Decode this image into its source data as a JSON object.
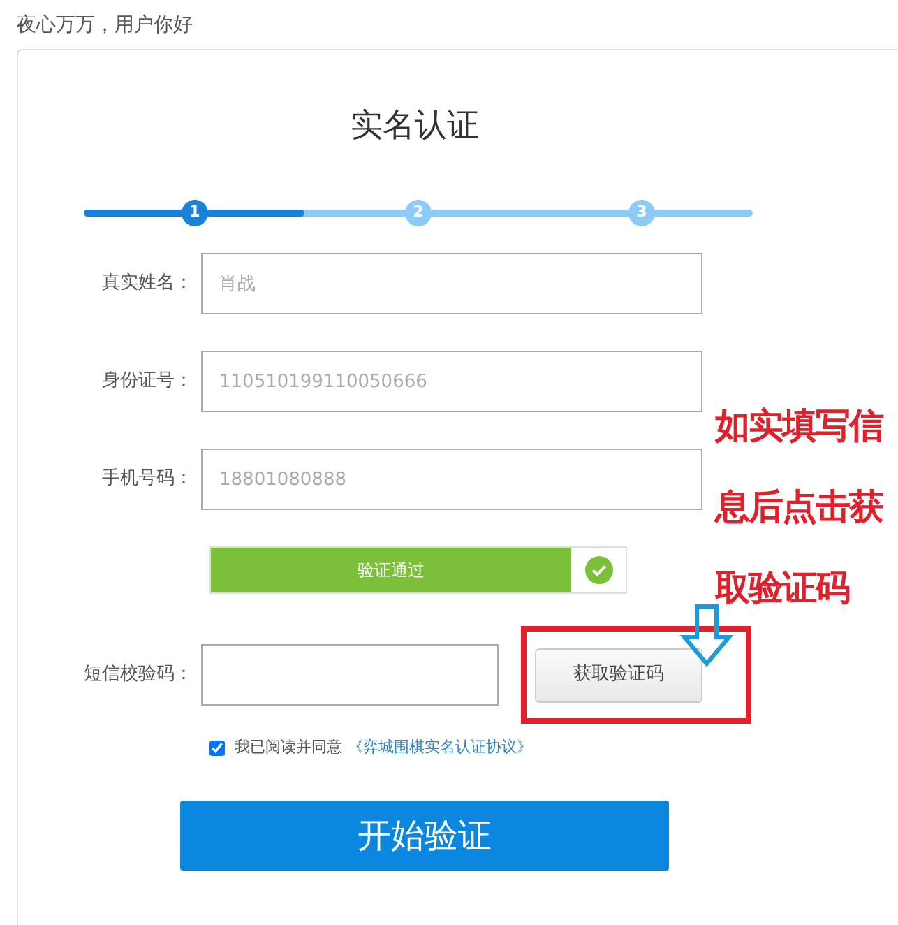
{
  "greeting": "夜心万万，用户你好",
  "title": "实名认证",
  "progress": {
    "level": 0.33,
    "steps": [
      {
        "label": "1",
        "done": true
      },
      {
        "label": "2",
        "done": false
      },
      {
        "label": "3",
        "done": false
      }
    ]
  },
  "fields": [
    {
      "label": "真实姓名：",
      "placeholder": "肖战"
    },
    {
      "label": "身份证号：",
      "placeholder": "110510199110050666"
    },
    {
      "label": "手机号码：",
      "placeholder": "18801080888"
    }
  ],
  "verify_bar": {
    "text": "验证通过",
    "passed": true
  },
  "sms": {
    "label": "短信校验码：",
    "button": "获取验证码"
  },
  "agreement": {
    "checked": true,
    "text": "我已阅读并同意",
    "link": "《弈城围棋实名认证协议》"
  },
  "submit": "开始验证",
  "annotation": {
    "lines": [
      "如实填写信",
      "息后点击获",
      "取验证码"
    ]
  }
}
